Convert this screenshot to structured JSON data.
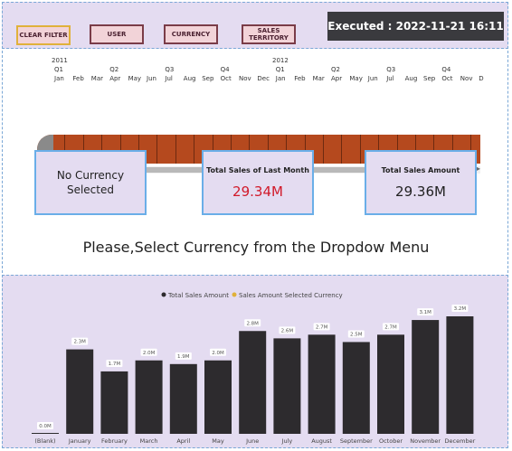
{
  "filters": {
    "clear_label": "CLEAR FILTER",
    "user_label": "USER",
    "currency_label": "CURRENCY",
    "territory_label": "SALES TERRITORY"
  },
  "executed": "Executed : 2022-11-21 16:11",
  "timeline": {
    "year1": "2011",
    "year2": "2012",
    "quarters": [
      "Q1",
      "Q2",
      "Q3",
      "Q4",
      "Q1",
      "Q2",
      "Q3",
      "Q4"
    ],
    "months": [
      "Jan",
      "Feb",
      "Mar",
      "Apr",
      "May",
      "Jun",
      "Jul",
      "Aug",
      "Sep",
      "Oct",
      "Nov",
      "Dec",
      "Jan",
      "Feb",
      "Mar",
      "Apr",
      "May",
      "Jun",
      "Jul",
      "Aug",
      "Sep",
      "Oct",
      "Nov",
      "D"
    ]
  },
  "cards": {
    "no_currency_line1": "No Currency",
    "no_currency_line2": "Selected",
    "last_month_title": "Total Sales of Last Month",
    "last_month_value": "29.34M",
    "total_title": "Total Sales Amount",
    "total_value": "29.36M"
  },
  "message": "Please,Select Currency from the Dropdow Menu",
  "colors": {
    "accent_red": "#d11a2a",
    "bar": "#2d2b2e",
    "legend_dot_1": "#2d2b2e",
    "legend_dot_2": "#e0b13a",
    "timeline_bar": "#b5491e"
  },
  "chart_data": {
    "type": "bar",
    "legend": [
      "Total Sales Amount",
      "Sales Amount Selected Currency"
    ],
    "categories": [
      "(Blank)",
      "January",
      "February",
      "March",
      "April",
      "May",
      "June",
      "July",
      "August",
      "September",
      "October",
      "November",
      "December"
    ],
    "values": [
      0.0,
      2.3,
      1.7,
      2.0,
      1.9,
      2.0,
      2.8,
      2.6,
      2.7,
      2.5,
      2.7,
      3.1,
      3.2
    ],
    "labels": [
      "0.0M",
      "2.3M",
      "1.7M",
      "2.0M",
      "1.9M",
      "2.0M",
      "2.8M",
      "2.6M",
      "2.7M",
      "2.5M",
      "2.7M",
      "3.1M",
      "3.2M"
    ],
    "ylim": [
      0,
      3.2
    ]
  }
}
